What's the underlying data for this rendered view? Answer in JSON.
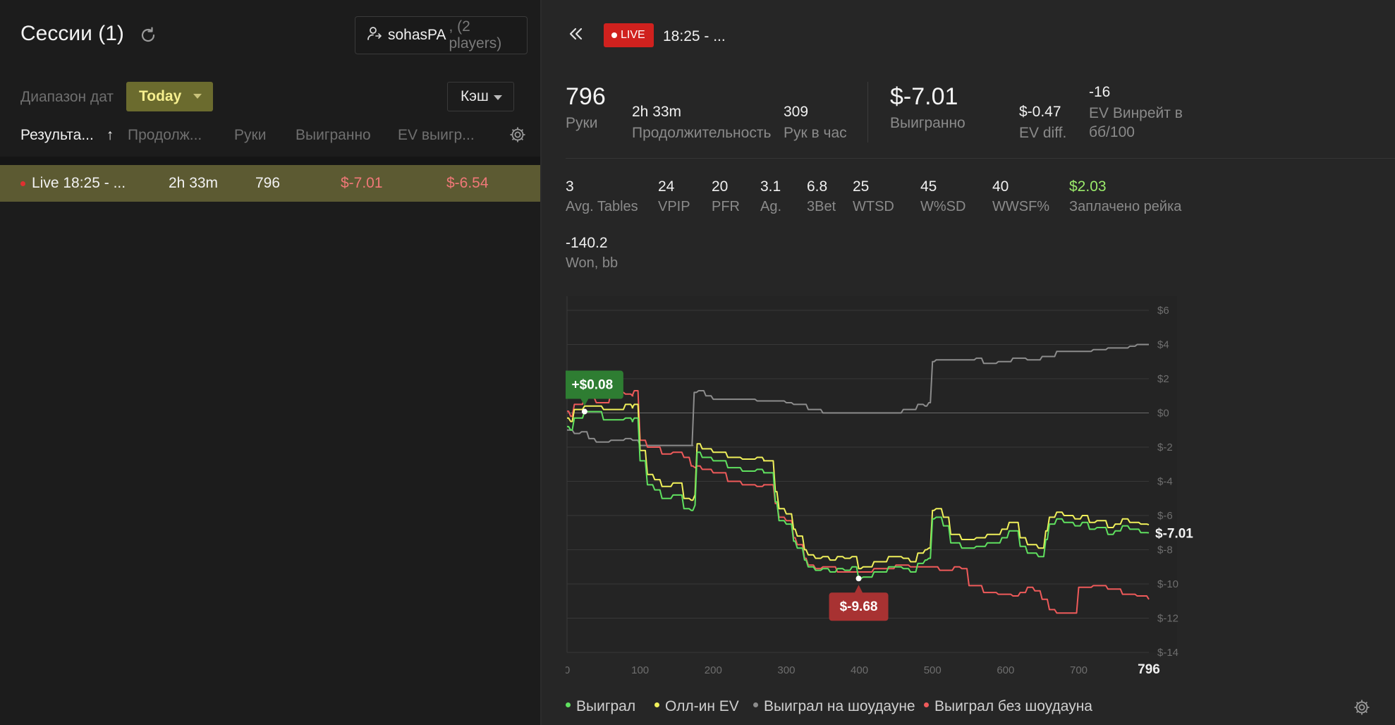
{
  "left": {
    "title": "Сессии (1)",
    "player_name": "sohasPA",
    "player_count": ", (2 players)",
    "date_range_label": "Диапазон дат",
    "date_range_value": "Today",
    "game_type": "Кэш",
    "columns": [
      "Результа...",
      "Продолж...",
      "Руки",
      "Выигранно",
      "EV выигр..."
    ],
    "sort_arrow": "↑",
    "sessions": [
      {
        "name": "Live 18:25 - ...",
        "duration": "2h 33m",
        "hands": "796",
        "won": "$-7.01",
        "ev_won": "$-6.54"
      }
    ]
  },
  "right": {
    "live_label": "LIVE",
    "session_title": "18:25 - ...",
    "stats_top": {
      "hands": {
        "value": "796",
        "label": "Руки"
      },
      "duration": {
        "value": "2h 33m",
        "label": "Продолжительность"
      },
      "hands_per_hour": {
        "value": "309",
        "label": "Рук в час"
      },
      "won": {
        "value": "$-7.01",
        "label": "Выигранно"
      },
      "ev_diff": {
        "value": "$-0.47",
        "label": "EV diff."
      },
      "ev_winrate": {
        "value": "-16",
        "label_1": "EV Винрейт в",
        "label_2": "бб/100"
      }
    },
    "stats_row": [
      {
        "value": "3",
        "label": "Avg. Tables"
      },
      {
        "value": "24",
        "label": "VPIP"
      },
      {
        "value": "20",
        "label": "PFR"
      },
      {
        "value": "3.1",
        "label": "Ag."
      },
      {
        "value": "6.8",
        "label": "3Bet"
      },
      {
        "value": "25",
        "label": "WTSD"
      },
      {
        "value": "45",
        "label": "W%SD"
      },
      {
        "value": "40",
        "label": "WWSF%"
      },
      {
        "value": "$2.03",
        "label": "Заплачено рейка"
      }
    ],
    "won_bb": {
      "value": "-140.2",
      "label": "Won, bb"
    },
    "legend": [
      "Выиграл",
      "Олл-ин EV",
      "Выиграл на шоудауне",
      "Выиграл без шоудауна"
    ]
  },
  "colors": {
    "won": "#5fe05f",
    "allin_ev": "#f0f05a",
    "showdown": "#8c8c8c",
    "non_showdown": "#ef5a5a",
    "negative": "#f07878",
    "positive": "#9bea6b",
    "today_bg": "#6b6b2e",
    "live_badge": "#d0211e"
  },
  "chart_data": {
    "type": "line",
    "xlabel": "",
    "ylabel": "",
    "xlim": [
      0,
      796
    ],
    "ylim": [
      -14,
      6
    ],
    "x_ticks": [
      "0",
      "100",
      "200",
      "300",
      "400",
      "500",
      "600",
      "700",
      "796"
    ],
    "y_ticks": [
      "$6",
      "$4",
      "$2",
      "$0",
      "$-2",
      "$-4",
      "$-6",
      "$-8",
      "$-10",
      "$-12",
      "$-14"
    ],
    "max_annotation": {
      "x": 24,
      "y": 0.08,
      "label": "+$0.08"
    },
    "min_annotation": {
      "x": 399,
      "y": -9.68,
      "label": "$-9.68"
    },
    "end_label": "$-7.01",
    "series": [
      {
        "name": "Выиграл",
        "x": [
          0,
          5,
          10,
          24,
          50,
          80,
          90,
          92,
          100,
          110,
          120,
          130,
          145,
          160,
          170,
          175,
          178,
          185,
          200,
          220,
          240,
          260,
          270,
          272,
          285,
          290,
          300,
          310,
          315,
          325,
          330,
          340,
          350,
          360,
          370,
          380,
          390,
          399,
          405,
          420,
          440,
          460,
          470,
          480,
          490,
          495,
          500,
          505,
          515,
          525,
          540,
          560,
          575,
          595,
          605,
          620,
          630,
          645,
          655,
          660,
          670,
          680,
          695,
          705,
          715,
          725,
          740,
          750,
          760,
          770,
          785,
          796
        ],
        "y": [
          -0.8,
          -1.0,
          -0.3,
          0.08,
          -0.4,
          -0.3,
          -0.5,
          -0.3,
          -2.8,
          -4.2,
          -4.5,
          -5.0,
          -4.8,
          -5.6,
          -5.7,
          -5.4,
          -2.3,
          -2.6,
          -2.8,
          -3.2,
          -3.4,
          -3.3,
          -3.5,
          -3.5,
          -5.2,
          -6.3,
          -6.5,
          -7.5,
          -7.9,
          -8.6,
          -9.0,
          -9.2,
          -9.1,
          -9.3,
          -9.1,
          -9.2,
          -9.0,
          -9.68,
          -9.6,
          -9.3,
          -9.0,
          -9.1,
          -9.3,
          -8.8,
          -8.6,
          -8.5,
          -6.2,
          -6.1,
          -6.6,
          -7.6,
          -7.9,
          -7.8,
          -7.6,
          -7.3,
          -6.9,
          -7.8,
          -8.2,
          -8.4,
          -7.4,
          -6.5,
          -6.2,
          -6.4,
          -6.6,
          -6.4,
          -6.8,
          -6.7,
          -7.1,
          -6.9,
          -6.6,
          -6.8,
          -7.0,
          -7.01
        ]
      },
      {
        "name": "Олл-ин EV",
        "x": [
          0,
          5,
          10,
          24,
          50,
          80,
          90,
          92,
          100,
          110,
          120,
          130,
          145,
          160,
          170,
          175,
          178,
          185,
          200,
          220,
          240,
          260,
          270,
          272,
          285,
          290,
          300,
          310,
          315,
          325,
          330,
          340,
          350,
          360,
          370,
          380,
          390,
          399,
          405,
          420,
          440,
          460,
          470,
          480,
          490,
          495,
          500,
          505,
          515,
          525,
          540,
          560,
          575,
          595,
          605,
          620,
          630,
          645,
          655,
          660,
          670,
          680,
          695,
          705,
          715,
          725,
          740,
          750,
          760,
          770,
          785,
          796
        ],
        "y": [
          -0.3,
          -0.5,
          0.2,
          0.4,
          0.2,
          0.5,
          0.3,
          0.5,
          -2.2,
          -3.6,
          -3.9,
          -4.3,
          -4.1,
          -5.0,
          -5.1,
          -4.8,
          -1.8,
          -2.1,
          -2.3,
          -2.6,
          -2.7,
          -2.6,
          -2.8,
          -2.8,
          -4.6,
          -5.6,
          -5.9,
          -6.8,
          -7.2,
          -8.0,
          -8.3,
          -8.5,
          -8.4,
          -8.6,
          -8.4,
          -8.5,
          -8.4,
          -9.1,
          -9.0,
          -8.7,
          -8.4,
          -8.5,
          -8.7,
          -8.2,
          -8.0,
          -7.9,
          -5.7,
          -5.6,
          -6.1,
          -7.1,
          -7.4,
          -7.3,
          -7.1,
          -6.8,
          -6.4,
          -7.3,
          -7.7,
          -7.9,
          -6.9,
          -6.1,
          -5.8,
          -6.0,
          -6.2,
          -6.0,
          -6.4,
          -6.3,
          -6.7,
          -6.5,
          -6.2,
          -6.4,
          -6.5,
          -6.54
        ]
      },
      {
        "name": "Выиграл на шоудауне",
        "x": [
          0,
          10,
          20,
          30,
          40,
          60,
          80,
          90,
          100,
          120,
          140,
          160,
          172,
          174,
          180,
          190,
          200,
          230,
          260,
          280,
          300,
          310,
          330,
          350,
          370,
          400,
          430,
          460,
          470,
          480,
          490,
          495,
          500,
          505,
          520,
          540,
          560,
          570,
          590,
          610,
          630,
          650,
          670,
          700,
          720,
          740,
          760,
          770,
          780,
          796
        ],
        "y": [
          -1.0,
          -1.2,
          -1.1,
          -1.5,
          -1.7,
          -1.6,
          -1.5,
          -1.6,
          -1.9,
          -1.9,
          -1.9,
          -1.9,
          -1.9,
          1.2,
          1.3,
          1.0,
          0.8,
          0.8,
          0.7,
          0.7,
          0.6,
          0.5,
          0.2,
          0.0,
          0.0,
          0.0,
          0.0,
          0.2,
          0.2,
          0.5,
          0.4,
          0.6,
          3.0,
          3.1,
          3.1,
          3.1,
          3.2,
          2.9,
          3.0,
          3.2,
          3.1,
          3.3,
          3.6,
          3.6,
          3.7,
          3.8,
          3.8,
          3.9,
          4.0,
          4.0
        ]
      },
      {
        "name": "Выиграл без шоудауна",
        "x": [
          0,
          5,
          10,
          24,
          40,
          60,
          80,
          90,
          92,
          100,
          110,
          130,
          145,
          160,
          170,
          175,
          178,
          185,
          200,
          220,
          240,
          260,
          270,
          272,
          285,
          290,
          300,
          310,
          315,
          325,
          330,
          340,
          350,
          370,
          399,
          420,
          450,
          470,
          490,
          510,
          530,
          540,
          550,
          570,
          590,
          610,
          620,
          630,
          640,
          650,
          660,
          670,
          680,
          700,
          720,
          740,
          760,
          780,
          796
        ],
        "y": [
          0.1,
          -0.2,
          0.5,
          0.9,
          0.6,
          1.2,
          1.1,
          1.0,
          1.3,
          -1.6,
          -2.0,
          -2.4,
          -2.3,
          -2.6,
          -3.1,
          -3.2,
          -3.1,
          -3.3,
          -3.5,
          -4.0,
          -4.2,
          -4.3,
          -4.2,
          -4.2,
          -5.3,
          -6.1,
          -6.3,
          -7.3,
          -7.7,
          -8.5,
          -8.9,
          -9.1,
          -9.0,
          -9.3,
          -9.3,
          -9.1,
          -8.9,
          -9.0,
          -9.0,
          -9.2,
          -9.0,
          -9.1,
          -10.1,
          -10.5,
          -10.6,
          -10.7,
          -10.5,
          -10.2,
          -10.4,
          -10.9,
          -11.5,
          -11.7,
          -11.7,
          -10.2,
          -10.1,
          -10.3,
          -10.6,
          -10.7,
          -10.9
        ]
      }
    ]
  }
}
